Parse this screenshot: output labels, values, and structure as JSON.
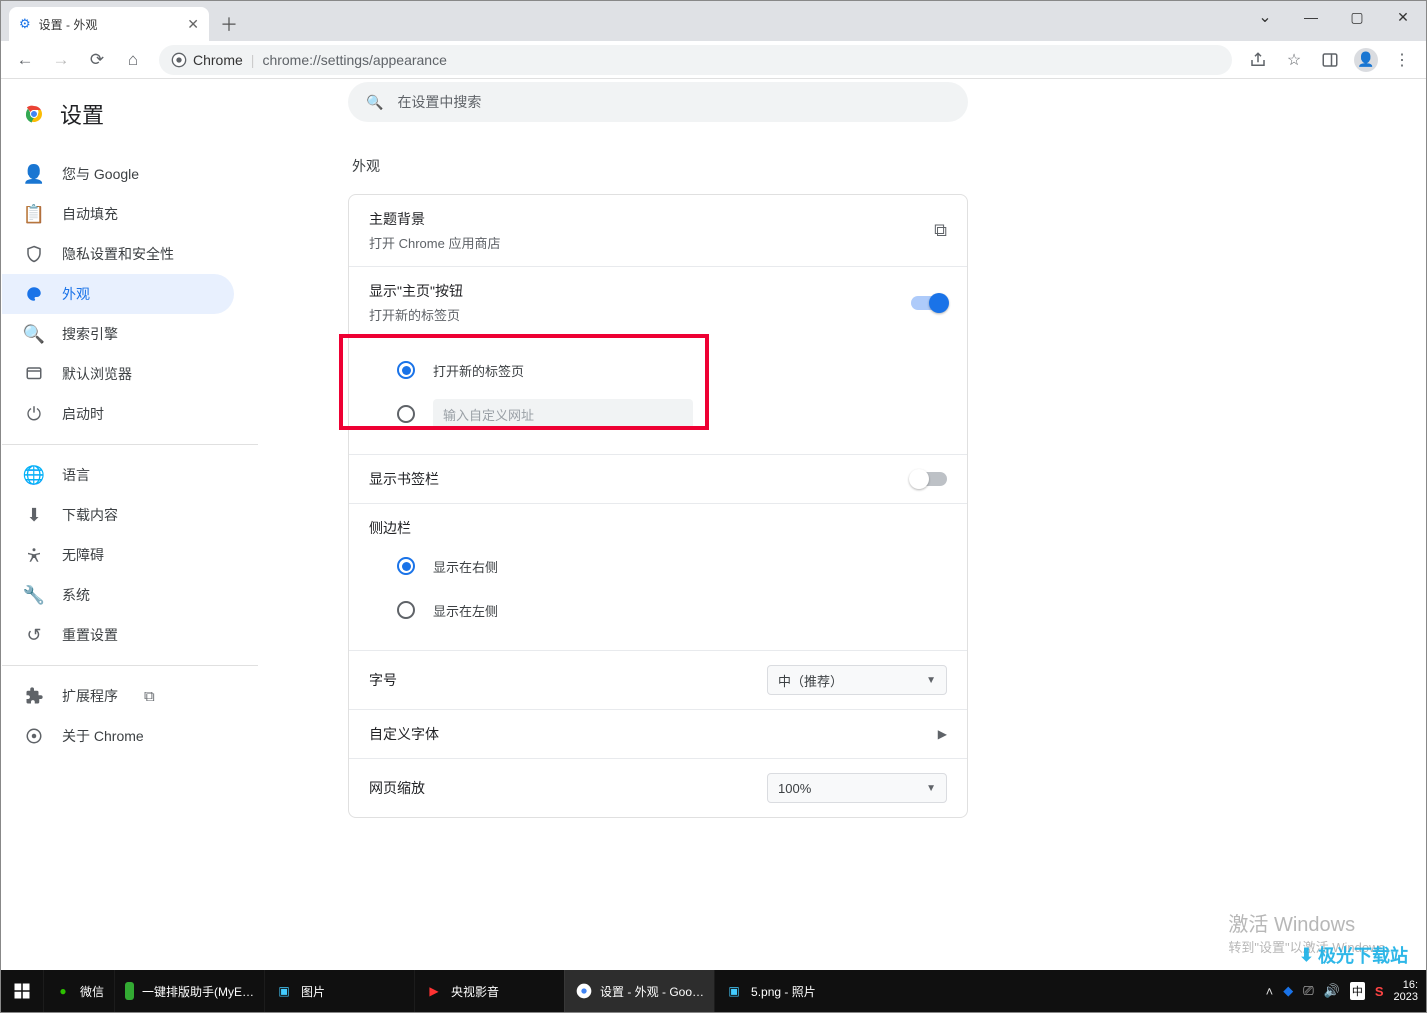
{
  "window": {
    "tab_title": "设置 - 外观",
    "minimize_glyph": "—",
    "maximize_glyph": "▢",
    "close_glyph": "✕",
    "dropdown_glyph": "⌄"
  },
  "addressbar": {
    "chrome_label": "Chrome",
    "url": "chrome://settings/appearance"
  },
  "settings": {
    "title": "设置",
    "search_placeholder": "在设置中搜索",
    "nav": [
      {
        "icon": "person",
        "label": "您与 Google"
      },
      {
        "icon": "autofill",
        "label": "自动填充"
      },
      {
        "icon": "shield",
        "label": "隐私设置和安全性"
      },
      {
        "icon": "palette",
        "label": "外观",
        "active": true
      },
      {
        "icon": "search",
        "label": "搜索引擎"
      },
      {
        "icon": "browser",
        "label": "默认浏览器"
      },
      {
        "icon": "power",
        "label": "启动时"
      }
    ],
    "nav2": [
      {
        "icon": "globe",
        "label": "语言"
      },
      {
        "icon": "download",
        "label": "下载内容"
      },
      {
        "icon": "accessibility",
        "label": "无障碍"
      },
      {
        "icon": "wrench",
        "label": "系统"
      },
      {
        "icon": "reset",
        "label": "重置设置"
      }
    ],
    "nav3": [
      {
        "icon": "extension",
        "label": "扩展程序",
        "launch": true
      },
      {
        "icon": "chrome",
        "label": "关于 Chrome"
      }
    ]
  },
  "appearance": {
    "section_title": "外观",
    "theme": {
      "title": "主题背景",
      "subtitle": "打开 Chrome 应用商店"
    },
    "home_button": {
      "title": "显示\"主页\"按钮",
      "subtitle": "打开新的标签页",
      "enabled": true,
      "options": {
        "newtab_label": "打开新的标签页",
        "custom_url_placeholder": "输入自定义网址",
        "selected": "newtab"
      }
    },
    "bookmarks_bar": {
      "title": "显示书签栏",
      "enabled": false
    },
    "sidepanel": {
      "title": "侧边栏",
      "right_label": "显示在右侧",
      "left_label": "显示在左侧",
      "selected": "right"
    },
    "font_size": {
      "title": "字号",
      "value": "中（推荐）"
    },
    "custom_fonts": {
      "title": "自定义字体"
    },
    "page_zoom": {
      "title": "网页缩放",
      "value": "100%"
    }
  },
  "watermark": {
    "line1": "激活 Windows",
    "line2": "转到\"设置\"以激活 Windows。"
  },
  "taskbar": {
    "items": [
      {
        "label": "微信"
      },
      {
        "label": "一键排版助手(MyE…"
      },
      {
        "label": "图片"
      },
      {
        "label": "央视影音"
      },
      {
        "label": "设置 - 外观 - Goo…",
        "active": true
      },
      {
        "label": "5.png - 照片"
      }
    ],
    "ime": "中",
    "clock_time": "16:",
    "clock_date": "2023"
  },
  "sitemark": "极光下载站"
}
